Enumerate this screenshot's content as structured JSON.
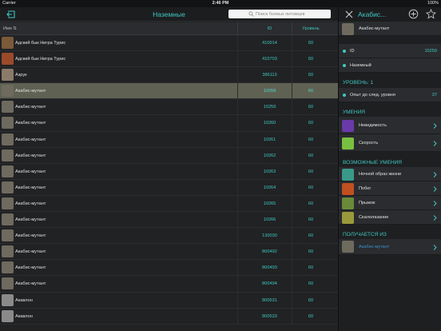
{
  "status": {
    "carrier": "Carrier",
    "time": "2:46 PM",
    "battery": "100%"
  },
  "left": {
    "title": "Наземные",
    "search_placeholder": "Поиск боевых питомцев",
    "columns": {
      "name": "Имя",
      "id": "ID",
      "level": "Уровень"
    },
    "rows": [
      {
        "name": "Адский бык Нигра Турис",
        "id": "410014",
        "level": "60",
        "icon_color": "#7a5a3a"
      },
      {
        "name": "Адский бык Нигра Турис",
        "id": "410703",
        "level": "60",
        "icon_color": "#9a4a2a"
      },
      {
        "name": "Азрук",
        "id": "386113",
        "level": "60",
        "icon_color": "#8a7a6a"
      },
      {
        "name": "Акабис-мутант",
        "id": "10259",
        "level": "60",
        "icon_color": "#6e6a5e",
        "selected": true
      },
      {
        "name": "Акабис-мутант",
        "id": "10259",
        "level": "60",
        "icon_color": "#6e6a5e"
      },
      {
        "name": "Акабис-мутант",
        "id": "10260",
        "level": "60",
        "icon_color": "#6e6a5e"
      },
      {
        "name": "Акабис-мутант",
        "id": "10261",
        "level": "60",
        "icon_color": "#6e6a5e"
      },
      {
        "name": "Акабис-мутант",
        "id": "10262",
        "level": "60",
        "icon_color": "#6e6a5e"
      },
      {
        "name": "Акабис-мутант",
        "id": "10263",
        "level": "60",
        "icon_color": "#6e6a5e"
      },
      {
        "name": "Акабис-мутант",
        "id": "10264",
        "level": "60",
        "icon_color": "#6e6a5e"
      },
      {
        "name": "Акабис-мутант",
        "id": "10265",
        "level": "60",
        "icon_color": "#6e6a5e"
      },
      {
        "name": "Акабис-мутант",
        "id": "10266",
        "level": "60",
        "icon_color": "#6e6a5e"
      },
      {
        "name": "Акабис-мутант",
        "id": "130030",
        "level": "60",
        "icon_color": "#6e6a5e"
      },
      {
        "name": "Акабис-мутант",
        "id": "800492",
        "level": "60",
        "icon_color": "#6e6a5e"
      },
      {
        "name": "Акабис-мутант",
        "id": "800493",
        "level": "60",
        "icon_color": "#6e6a5e"
      },
      {
        "name": "Акабис-мутант",
        "id": "800494",
        "level": "60",
        "icon_color": "#6e6a5e"
      },
      {
        "name": "Акавлон",
        "id": "800531",
        "level": "60",
        "icon_color": "#8a8a8a"
      },
      {
        "name": "Акавлон",
        "id": "800533",
        "level": "60",
        "icon_color": "#8a8a8a"
      }
    ]
  },
  "right": {
    "title": "Акабис...",
    "header_name": "Акабис-мутант",
    "id_label": "ID",
    "id_value": "10259",
    "type": "Наземный",
    "level_section": "УРОВЕНЬ: 1",
    "xp_label": "Опыт до след. уровня",
    "xp_value": "37",
    "skills_section": "УМЕНИЯ",
    "skills": [
      {
        "label": "Невидимость",
        "icon_color": "#6a3aa8"
      },
      {
        "label": "Скорость",
        "icon_color": "#7ac040"
      }
    ],
    "possible_section": "ВОЗМОЖНЫЕ УМЕНИЯ",
    "possible": [
      {
        "label": "Ночной образ жизни",
        "icon_color": "#3a9a8a"
      },
      {
        "label": "Побег",
        "icon_color": "#c05020"
      },
      {
        "label": "Прыжок",
        "icon_color": "#6a8a3a"
      },
      {
        "label": "Скалолазание",
        "icon_color": "#9a9a3a"
      }
    ],
    "from_section": "ПОЛУЧАЕТСЯ ИЗ",
    "from_label": "Акабис-мутант"
  }
}
